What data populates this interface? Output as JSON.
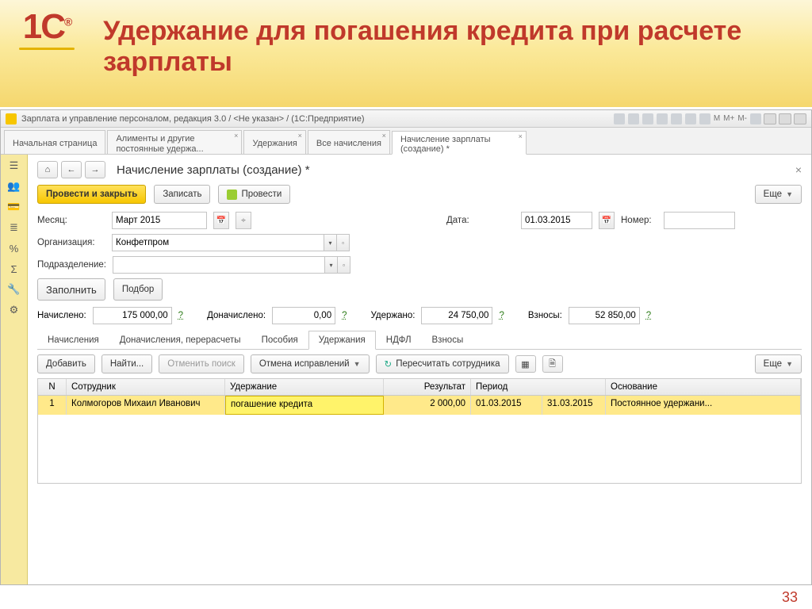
{
  "slide": {
    "logo": "1С®",
    "title": "Удержание для погашения кредита при расчете зарплаты",
    "page": "33"
  },
  "titlebar": {
    "text": "Зарплата и управление персоналом, редакция 3.0 / <Не указан> / (1С:Предприятие)",
    "m_labels": [
      "M",
      "M+",
      "M-"
    ]
  },
  "maintabs": [
    {
      "label": "Начальная страница"
    },
    {
      "label": "Алименты и другие постоянные удержа..."
    },
    {
      "label": "Удержания"
    },
    {
      "label": "Все начисления"
    },
    {
      "label": "Начисление зарплаты (создание) *",
      "active": true
    }
  ],
  "sidebar_icons": [
    "menu",
    "users",
    "card",
    "list",
    "percent",
    "sum",
    "wrench",
    "gear"
  ],
  "page": {
    "title": "Начисление зарплаты (создание) *",
    "buttons": {
      "post_close": "Провести и закрыть",
      "save": "Записать",
      "post": "Провести",
      "more": "Еще",
      "fill": "Заполнить",
      "select": "Подбор",
      "add": "Добавить",
      "find": "Найти...",
      "cancel_find": "Отменить поиск",
      "cancel_fix": "Отмена исправлений",
      "recalc": "Пересчитать сотрудника"
    },
    "labels": {
      "month": "Месяц:",
      "date": "Дата:",
      "number": "Номер:",
      "org": "Организация:",
      "dept": "Подразделение:",
      "accrued": "Начислено:",
      "extra": "Доначислено:",
      "withheld": "Удержано:",
      "contrib": "Взносы:"
    },
    "values": {
      "month": "Март 2015",
      "date": "01.03.2015",
      "number": "",
      "org": "Конфетпром",
      "dept": "",
      "accrued": "175 000,00",
      "extra": "0,00",
      "withheld": "24 750,00",
      "contrib": "52 850,00",
      "help": "?"
    },
    "subtabs": [
      "Начисления",
      "Доначисления, перерасчеты",
      "Пособия",
      "Удержания",
      "НДФЛ",
      "Взносы"
    ],
    "active_subtab": 3,
    "grid": {
      "cols": {
        "n": "N",
        "emp": "Сотрудник",
        "ded": "Удержание",
        "res": "Результат",
        "per": "Период",
        "bas": "Основание"
      },
      "row": {
        "n": "1",
        "emp": "Колмогоров Михаил Иванович",
        "ded": "погашение кредита",
        "res": "2 000,00",
        "per_from": "01.03.2015",
        "per_to": "31.03.2015",
        "bas": "Постоянное удержани..."
      }
    }
  }
}
